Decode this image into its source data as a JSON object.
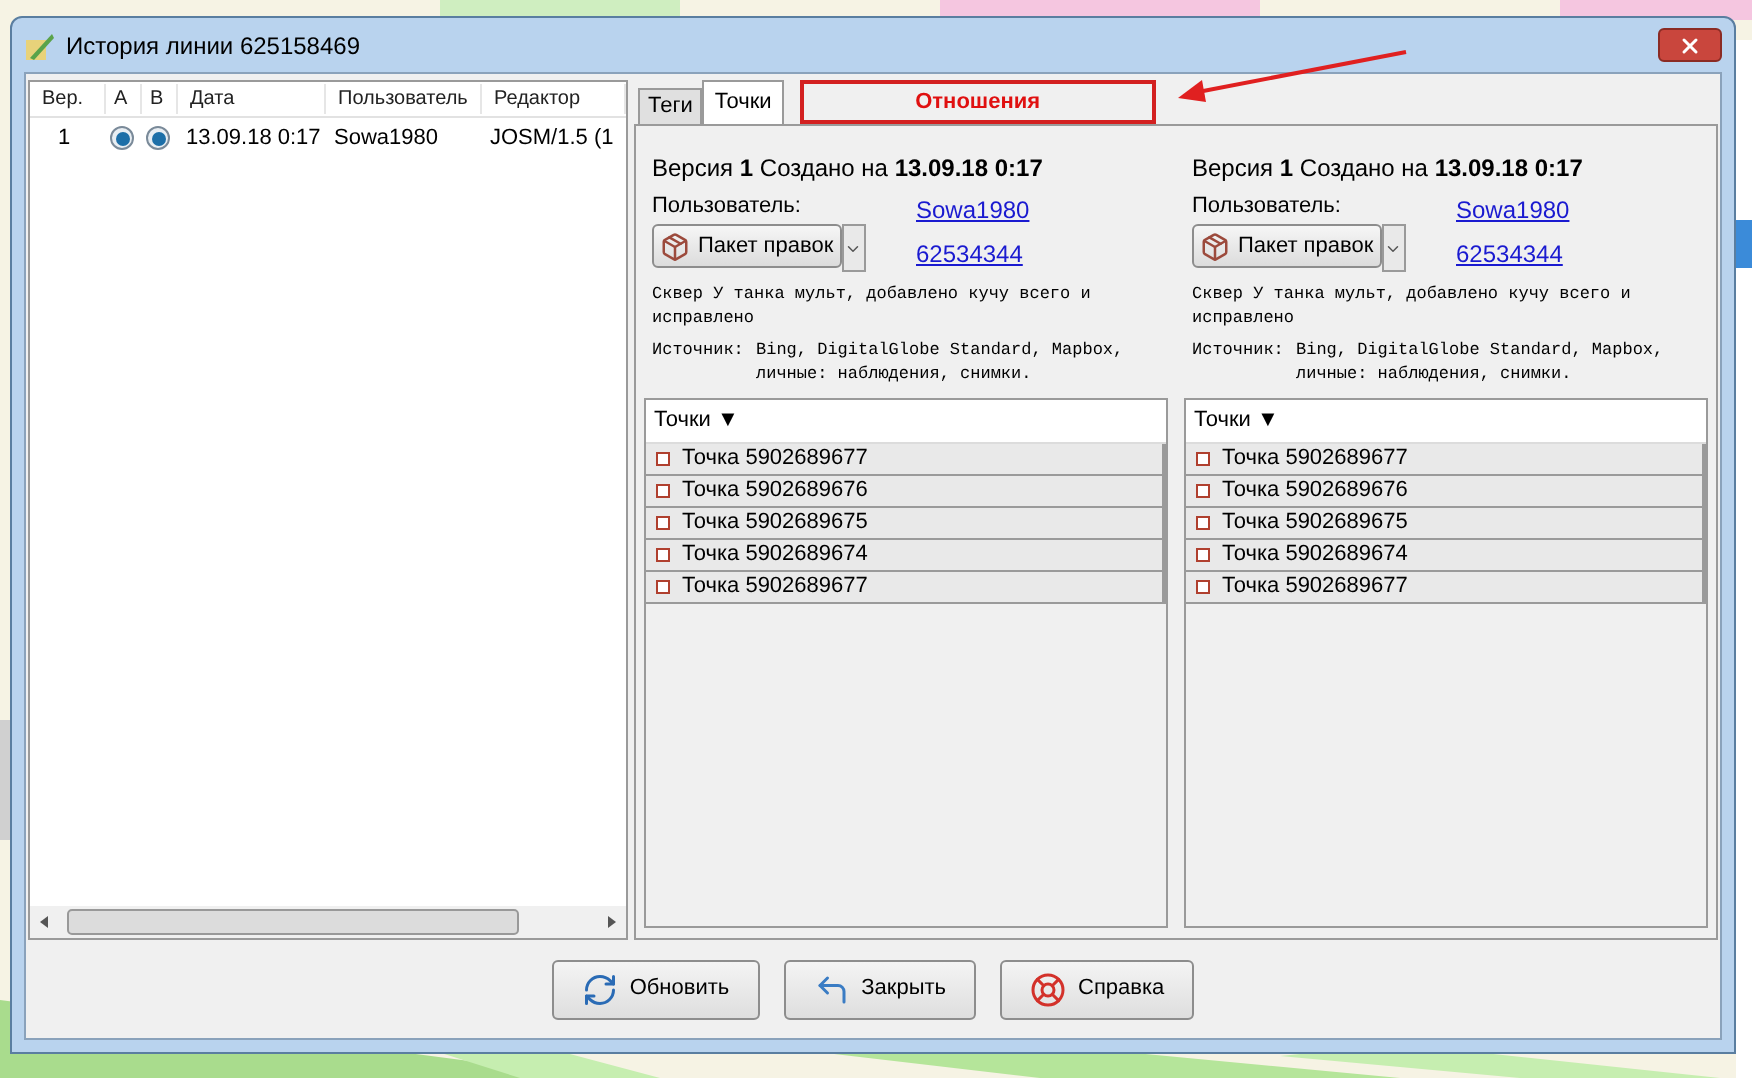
{
  "window": {
    "title": "История линии 625158469"
  },
  "history_table": {
    "columns": [
      "Вер.",
      "А",
      "В",
      "Дата",
      "Пользователь",
      "Редактор"
    ],
    "rows": [
      {
        "version": "1",
        "a_selected": true,
        "b_selected": true,
        "date": "13.09.18 0:17",
        "user": "Sowa1980",
        "editor": "JOSM/1.5 (1"
      }
    ]
  },
  "tabs": [
    {
      "label": "Теги",
      "selected": false,
      "annotated": false
    },
    {
      "label": "Точки",
      "selected": true,
      "annotated": false
    },
    {
      "label": "Отношения",
      "selected": false,
      "annotated": true
    }
  ],
  "versions": [
    {
      "heading": "Версия **1** Создано на **13.09.18 0:17**",
      "user_label": "Пользователь:",
      "user": "Sowa1980",
      "changeset_button": "Пакет правок",
      "changeset_id": "62534344",
      "comment": "Сквер У танка мульт, добавлено кучу всего и исправлено",
      "source_label": "Источник:",
      "source": "Bing, DigitalGlobe Standard, Mapbox, личные: наблюдения, снимки.",
      "list_header": "Точки ▼",
      "nodes": [
        "Точка 5902689677",
        "Точка 5902689676",
        "Точка 5902689675",
        "Точка 5902689674",
        "Точка 5902689677"
      ]
    },
    {
      "heading": "Версия **1** Создано на **13.09.18 0:17**",
      "user_label": "Пользователь:",
      "user": "Sowa1980",
      "changeset_button": "Пакет правок",
      "changeset_id": "62534344",
      "comment": "Сквер У танка мульт, добавлено кучу всего и исправлено",
      "source_label": "Источник:",
      "source": "Bing, DigitalGlobe Standard, Mapbox, личные: наблюдения, снимки.",
      "list_header": "Точки ▼",
      "nodes": [
        "Точка 5902689677",
        "Точка 5902689676",
        "Точка 5902689675",
        "Точка 5902689674",
        "Точка 5902689677"
      ]
    }
  ],
  "buttons": [
    {
      "label": "Обновить",
      "kind": "refresh"
    },
    {
      "label": "Закрыть",
      "kind": "close"
    },
    {
      "label": "Справка",
      "kind": "help"
    }
  ]
}
